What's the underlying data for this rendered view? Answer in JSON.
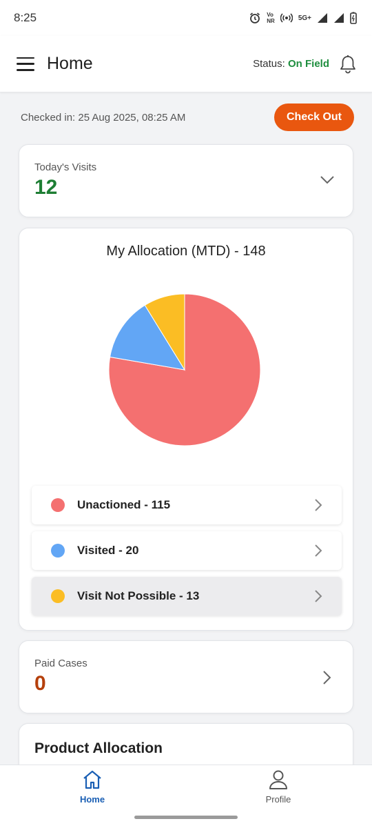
{
  "status_bar": {
    "time": "8:25",
    "volte": "Vo\nNR",
    "network": "5G+"
  },
  "app_bar": {
    "title": "Home",
    "status_label": "Status:",
    "status_value": "On Field"
  },
  "checkin": {
    "text": "Checked in: 25 Aug 2025, 08:25 AM",
    "button_label": "Check Out"
  },
  "visits": {
    "label": "Today's Visits",
    "value": "12"
  },
  "allocation": {
    "title": "My Allocation (MTD) - 148",
    "items": [
      {
        "label": "Unactioned - 115",
        "color": "#f47070"
      },
      {
        "label": "Visited - 20",
        "color": "#62a6f5"
      },
      {
        "label": "Visit Not Possible - 13",
        "color": "#fbbd24"
      }
    ]
  },
  "chart_data": {
    "type": "pie",
    "title": "My Allocation (MTD) - 148",
    "categories": [
      "Unactioned",
      "Visited",
      "Visit Not Possible"
    ],
    "values": [
      115,
      20,
      13
    ],
    "colors": [
      "#f47070",
      "#62a6f5",
      "#fbbd24"
    ]
  },
  "paid_cases": {
    "label": "Paid Cases",
    "value": "0"
  },
  "product_allocation": {
    "title": "Product Allocation"
  },
  "bottom_nav": {
    "home_label": "Home",
    "profile_label": "Profile"
  }
}
